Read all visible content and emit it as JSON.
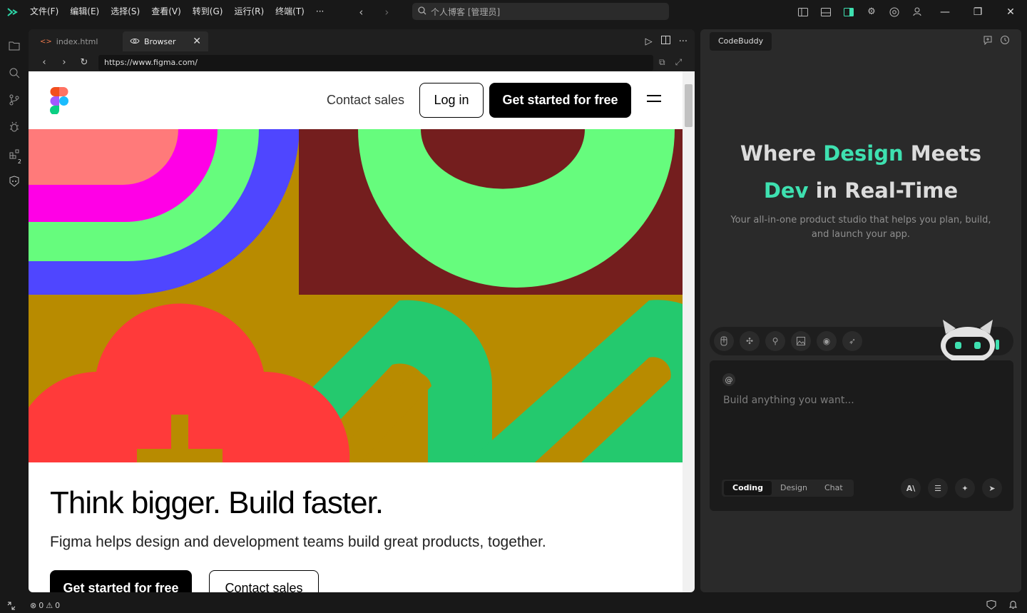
{
  "titlebar": {
    "menus": [
      "文件(F)",
      "编辑(E)",
      "选择(S)",
      "查看(V)",
      "转到(G)",
      "运行(R)",
      "终端(T)"
    ],
    "more": "···",
    "search_text": "个人博客 [管理员]"
  },
  "activitybar": {
    "extensions_badge": "2"
  },
  "editor": {
    "tabs": [
      {
        "label": "index.html",
        "icon": "code-icon"
      },
      {
        "label": "Browser",
        "icon": "eye-icon"
      }
    ],
    "url": "https://www.figma.com/"
  },
  "figma": {
    "nav": {
      "contact": "Contact sales",
      "login": "Log in",
      "get_started": "Get started for free"
    },
    "hero": {
      "title": "Think bigger. Build faster.",
      "subtitle": "Figma helps design and development teams build great products, together.",
      "cta_primary": "Get started for free",
      "cta_secondary": "Contact sales"
    },
    "colors": {
      "olive": "#b88b00",
      "maroon": "#741e1e",
      "green": "#66fc7d",
      "blue": "#4f46ff",
      "magenta": "#ff00e6",
      "salmon": "#ff7a7a",
      "red": "#ff3a3a",
      "emerald": "#24c96e"
    }
  },
  "panel": {
    "tab": "CodeBuddy",
    "title_parts": {
      "p1": "Where ",
      "p2": "Design",
      "p3": " Meets",
      "p4": "Dev",
      "p5": " in Real-Time"
    },
    "subtitle": "Your all-in-one product studio that helps you plan, build, and launch your app.",
    "input_placeholder": "Build anything you want...",
    "modes": [
      "Coding",
      "Design",
      "Chat"
    ],
    "accent_color": "#3ee0b0"
  },
  "statusbar": {
    "errors": "0",
    "warnings": "0"
  }
}
